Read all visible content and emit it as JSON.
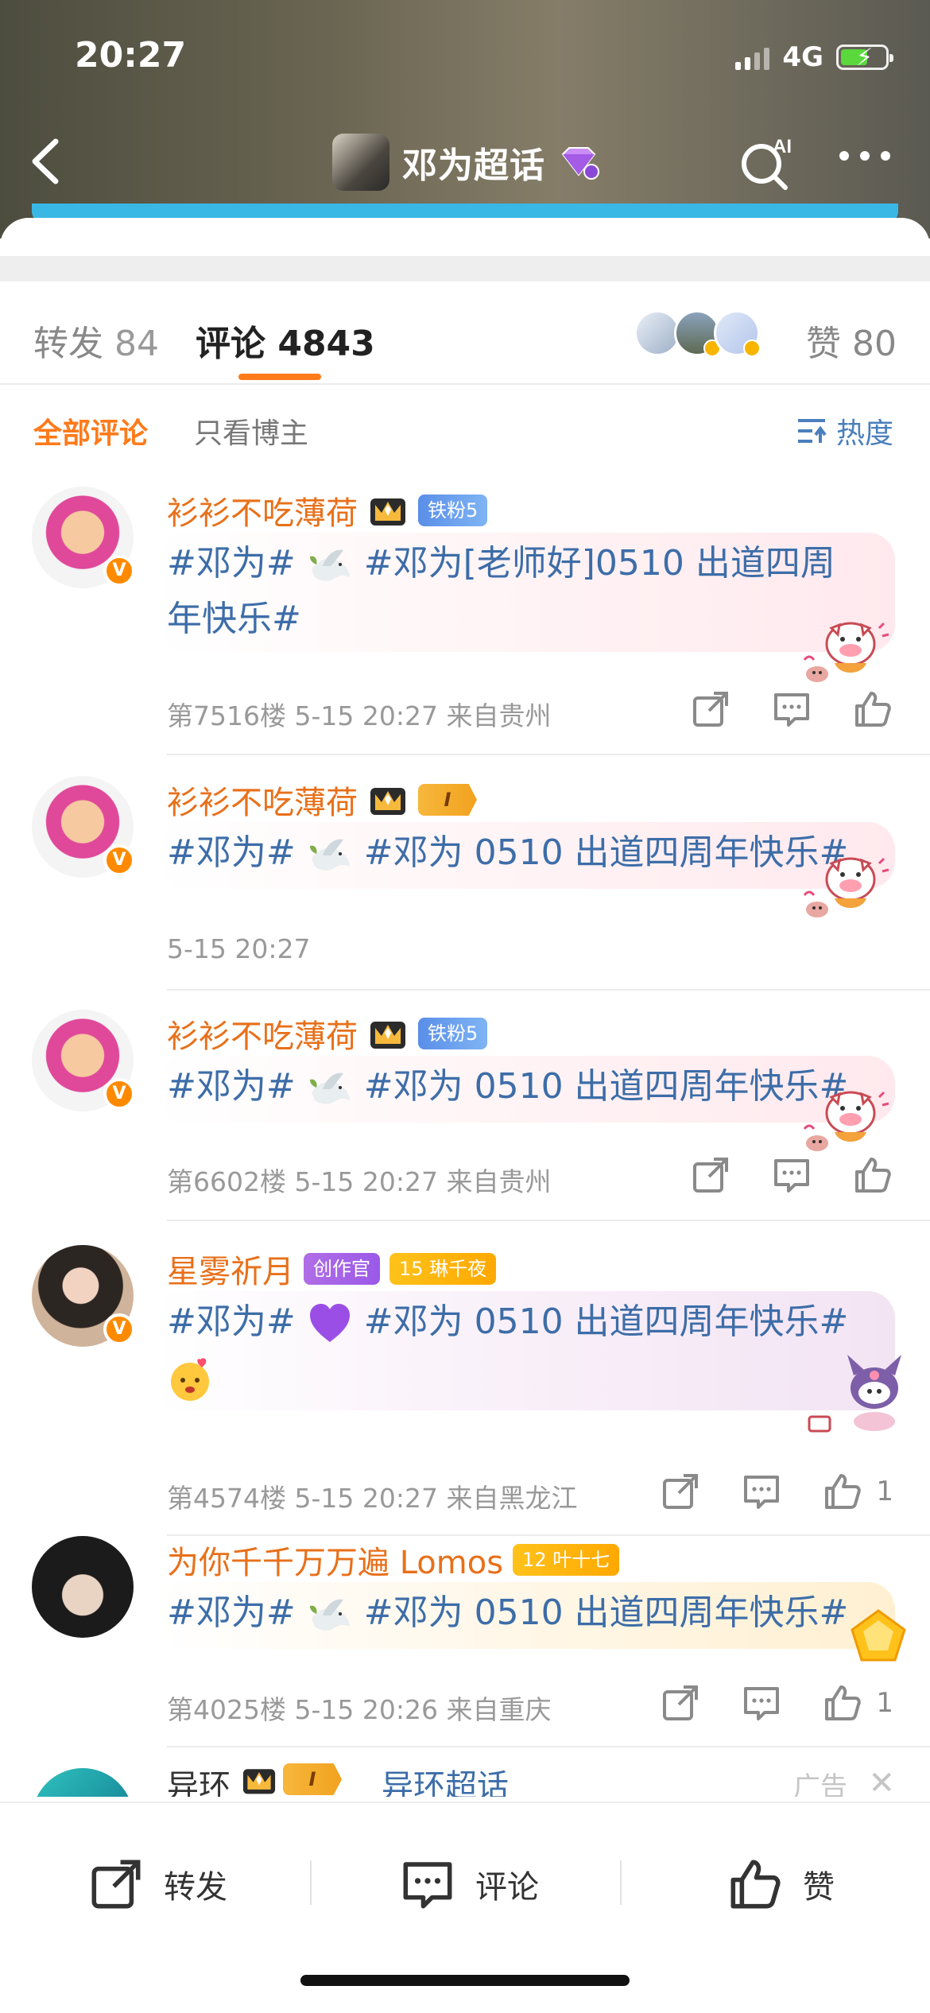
{
  "status_bar": {
    "time": "20:27",
    "network": "4G"
  },
  "nav": {
    "title": "邓为超话"
  },
  "tabs": {
    "repost_label": "转发",
    "repost_count": "84",
    "comment_label": "评论",
    "comment_count": "4843",
    "like_label": "赞",
    "like_count": "80"
  },
  "filters": {
    "all": "全部评论",
    "owner_only": "只看博主",
    "sort": "热度"
  },
  "comments": [
    {
      "name": "衫衫不吃薄荷",
      "badge": "铁粉5",
      "text_a": "#邓为#",
      "text_b": "#邓为[老师好]0510 出道四周年快乐#",
      "floor": "第7516楼",
      "time": "5-15 20:27",
      "location": "来自贵州"
    },
    {
      "name": "衫衫不吃薄荷",
      "badge": "I",
      "text_a": "#邓为#",
      "text_b": "#邓为 0510 出道四周年快乐#",
      "time": "5-15 20:27"
    },
    {
      "name": "衫衫不吃薄荷",
      "badge": "铁粉5",
      "text_a": "#邓为#",
      "text_b": "#邓为 0510 出道四周年快乐#",
      "floor": "第6602楼",
      "time": "5-15 20:27",
      "location": "来自贵州"
    },
    {
      "name": "星雾祈月",
      "badge": "创作官",
      "badge2_level": "15",
      "badge2": "琳千夜",
      "text_a": "#邓为#",
      "text_b": "#邓为 0510 出道四周年快乐#",
      "floor": "第4574楼",
      "time": "5-15 20:27",
      "location": "来自黑龙江",
      "likes": "1"
    },
    {
      "name": "为你千千万万遍 Lomos",
      "badge_level": "12",
      "badge": "叶十七",
      "text_a": "#邓为#",
      "text_b": "#邓为 0510 出道四周年快乐#",
      "floor": "第4025楼",
      "time": "5-15 20:26",
      "location": "来自重庆",
      "likes": "1"
    }
  ],
  "ad": {
    "name": "异环",
    "badge": "I",
    "topic": "异环超话",
    "label": "广告"
  },
  "bottom_bar": {
    "repost": "转发",
    "comment": "评论",
    "like": "赞"
  },
  "colors": {
    "accent": "#ff7a1a",
    "username": "#e8701a",
    "link": "#3d6da8"
  }
}
